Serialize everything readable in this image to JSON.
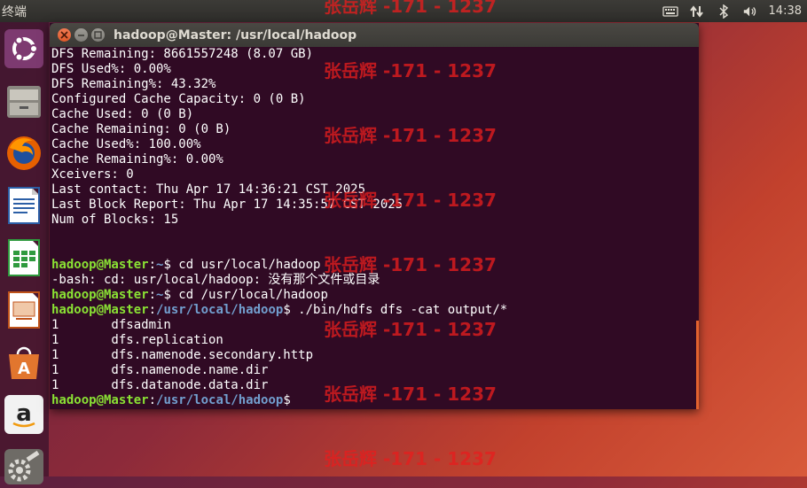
{
  "panel": {
    "app_title": "终端",
    "time": "14:38",
    "icons": [
      "keyboard-icon",
      "network-icon",
      "bluetooth-icon",
      "volume-icon"
    ]
  },
  "launcher": [
    "ubuntu-dash-icon",
    "files-icon",
    "firefox-icon",
    "writer-icon",
    "calc-icon",
    "impress-icon",
    "software-center-icon",
    "amazon-icon",
    "settings-icon"
  ],
  "window": {
    "title": "hadoop@Master: /usr/local/hadoop"
  },
  "terminal": {
    "lines": [
      {
        "text": "DFS Remaining: 8661557248 (8.07 GB)"
      },
      {
        "text": "DFS Used%: 0.00%"
      },
      {
        "text": "DFS Remaining%: 43.32%"
      },
      {
        "text": "Configured Cache Capacity: 0 (0 B)"
      },
      {
        "text": "Cache Used: 0 (0 B)"
      },
      {
        "text": "Cache Remaining: 0 (0 B)"
      },
      {
        "text": "Cache Used%: 100.00%"
      },
      {
        "text": "Cache Remaining%: 0.00%"
      },
      {
        "text": "Xceivers: 0"
      },
      {
        "text": "Last contact: Thu Apr 17 14:36:21 CST 2025"
      },
      {
        "text": "Last Block Report: Thu Apr 17 14:35:57 CST 2025"
      },
      {
        "text": "Num of Blocks: 15"
      },
      {
        "text": ""
      },
      {
        "text": ""
      },
      {
        "user": "hadoop@Master",
        "path": "~",
        "cmd": "$ cd usr/local/hadoop"
      },
      {
        "text": "-bash: cd: usr/local/hadoop: 没有那个文件或目录"
      },
      {
        "user": "hadoop@Master",
        "path": "~",
        "cmd": "$ cd /usr/local/hadoop"
      },
      {
        "user": "hadoop@Master",
        "path": "/usr/local/hadoop",
        "cmd": "$ ./bin/hdfs dfs -cat output/*"
      },
      {
        "text": "1       dfsadmin"
      },
      {
        "text": "1       dfs.replication"
      },
      {
        "text": "1       dfs.namenode.secondary.http"
      },
      {
        "text": "1       dfs.namenode.name.dir"
      },
      {
        "text": "1       dfs.datanode.data.dir"
      },
      {
        "user": "hadoop@Master",
        "path": "/usr/local/hadoop",
        "cmd": "$ "
      }
    ]
  },
  "watermark": "张岳辉 -171 - 1237"
}
